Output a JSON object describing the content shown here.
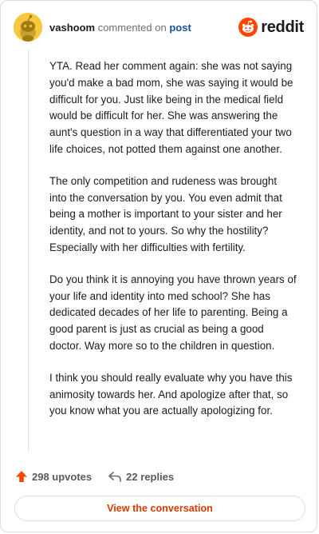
{
  "header": {
    "username": "vashoom",
    "action": "commented on",
    "target": "post",
    "brand": "reddit"
  },
  "comment": {
    "paragraphs": [
      "YTA. Read her comment again: she was not saying you'd make a bad mom, she was saying it would be difficult for you. Just like being in the medical field would be difficult for her. She was answering the aunt's question in a way that differentiated your two life choices, not potted them against one another.",
      "The only competition and rudeness was brought into the conversation by you. You even admit that being a mother is important to your sister and her identity, and not to yours. So why the hostility? Especially with her difficulties with fertility.",
      "Do you think it is annoying you have thrown years of your life and identity into med school? She has dedicated decades of her life to parenting. Being a good parent is just as crucial as being a good doctor. Way more so to the children in question.",
      "I think you should really evaluate why you have this animosity towards her. And apologize after that, so you know what you are actually apologizing for."
    ]
  },
  "footer": {
    "upvotes": "298 upvotes",
    "replies": "22 replies",
    "cta": "View the conversation"
  },
  "colors": {
    "upvote": "#ff4500",
    "link": "#1d4e9e",
    "cta": "#d93a00",
    "avatar": "#f7c83e"
  },
  "icons": {
    "avatar": "snoo-avatar-icon",
    "brand": "reddit-logo-icon",
    "upvote": "upvote-arrow-icon",
    "reply": "reply-arrow-icon"
  }
}
